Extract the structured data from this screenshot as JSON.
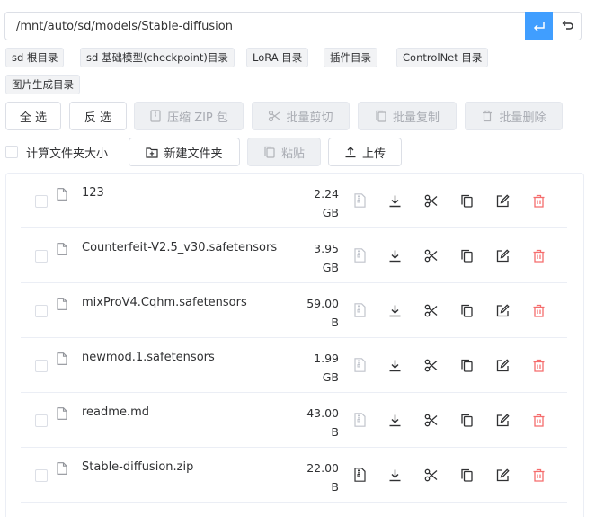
{
  "path": {
    "value": "/mnt/auto/sd/models/Stable-diffusion"
  },
  "quick_dirs": [
    {
      "label": "sd 根目录"
    },
    {
      "label": "sd 基础模型(checkpoint)目录"
    },
    {
      "label": "LoRA 目录"
    },
    {
      "label": "插件目录"
    },
    {
      "label": "ControlNet 目录"
    },
    {
      "label": "图片生成目录"
    }
  ],
  "toolbar": {
    "select_all": "全 选",
    "invert": "反 选",
    "zip": "压缩 ZIP 包",
    "batch_cut": "批量剪切",
    "batch_copy": "批量复制",
    "batch_delete": "批量删除",
    "calc_size": "计算文件夹大小",
    "new_folder": "新建文件夹",
    "paste": "粘贴",
    "upload": "上传"
  },
  "files": [
    {
      "name": "123",
      "size_num": "2.24",
      "size_unit": "GB",
      "extract_enabled": false
    },
    {
      "name": "Counterfeit-V2.5_v30.safetensors",
      "size_num": "3.95",
      "size_unit": "GB",
      "extract_enabled": false
    },
    {
      "name": "mixProV4.Cqhm.safetensors",
      "size_num": "59.00",
      "size_unit": "B",
      "extract_enabled": false
    },
    {
      "name": "newmod.1.safetensors",
      "size_num": "1.99",
      "size_unit": "GB",
      "extract_enabled": false
    },
    {
      "name": "readme.md",
      "size_num": "43.00",
      "size_unit": "B",
      "extract_enabled": false
    },
    {
      "name": "Stable-diffusion.zip",
      "size_num": "22.00",
      "size_unit": "B",
      "extract_enabled": true
    }
  ],
  "colors": {
    "primary": "#409eff",
    "danger": "#f56c6c",
    "disabled": "#c0c4cc"
  }
}
